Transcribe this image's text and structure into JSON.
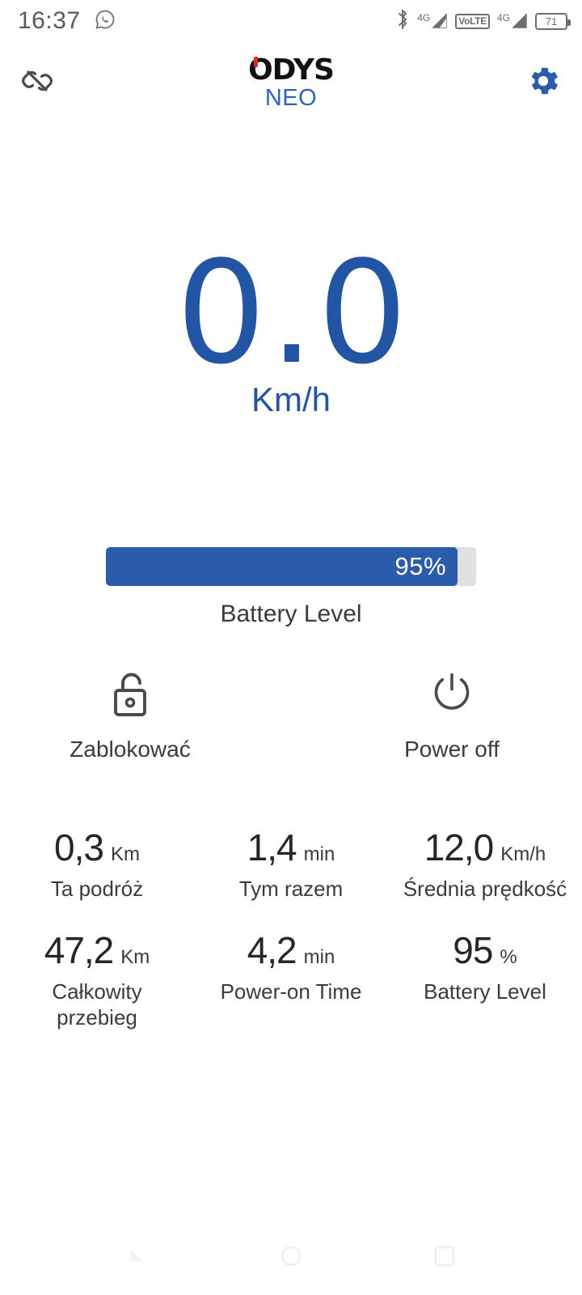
{
  "statusbar": {
    "clock": "16:37",
    "whatsapp_icon": "whatsapp-icon",
    "bluetooth_icon": "bluetooth-icon",
    "sim1_gen": "4G",
    "volte": "VoLTE",
    "sim2_gen": "4G",
    "battery_text": "71"
  },
  "header": {
    "link_icon": "broken-link-icon",
    "brand": "ODYS",
    "model": "NEO",
    "settings_icon": "gear-icon"
  },
  "speedometer": {
    "value": "0.0",
    "unit": "Km/h"
  },
  "battery_bar": {
    "percent_text": "95%",
    "percent": 95,
    "caption": "Battery Level"
  },
  "actions": [
    {
      "icon": "unlocked-padlock-icon",
      "label": "Zablokować"
    },
    {
      "icon": "power-icon",
      "label": "Power off"
    }
  ],
  "stats": [
    [
      {
        "value": "0,3",
        "unit": "Km",
        "label": "Ta podróż"
      },
      {
        "value": "1,4",
        "unit": "min",
        "label": "Tym razem"
      },
      {
        "value": "12,0",
        "unit": "Km/h",
        "label": "Średnia prędkość"
      }
    ],
    [
      {
        "value": "47,2",
        "unit": "Km",
        "label": "Całkowity przebieg"
      },
      {
        "value": "4,2",
        "unit": "min",
        "label": "Power-on Time"
      },
      {
        "value": "95",
        "unit": "%",
        "label": "Battery Level"
      }
    ]
  ],
  "navbar": {
    "back_icon": "back-icon",
    "home_icon": "home-icon",
    "recents_icon": "recents-icon"
  },
  "colors": {
    "accent_blue": "#2b5cab",
    "speed_blue": "#2255a4",
    "model_blue": "#2f63b5",
    "brand_red": "#d62b20",
    "track_gray": "#e0e0e0"
  }
}
